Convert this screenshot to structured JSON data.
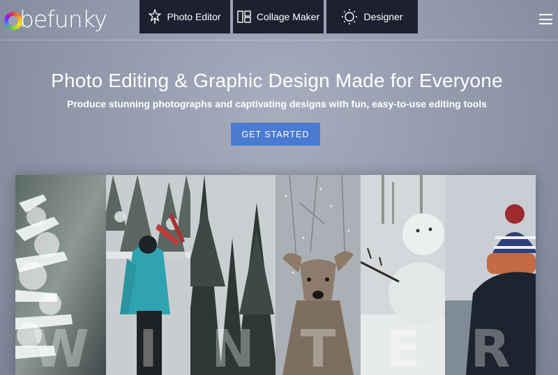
{
  "brand": {
    "logo_text": "befunky"
  },
  "nav": {
    "tabs": [
      {
        "label": "Photo Editor",
        "icon": "star-wand-icon"
      },
      {
        "label": "Collage Maker",
        "icon": "collage-grid-icon"
      },
      {
        "label": "Designer",
        "icon": "designer-sun-icon"
      }
    ],
    "menu_icon": "hamburger-menu-icon"
  },
  "hero": {
    "title": "Photo Editing & Graphic Design Made for Everyone",
    "subtitle": "Produce stunning photographs and captivating designs with fun, easy-to-use editing tools",
    "cta_label": "GET STARTED"
  },
  "gallery": {
    "letters": [
      "W",
      "I",
      "N",
      "T",
      "E",
      "R"
    ]
  },
  "colors": {
    "nav_bg": "#1d2030",
    "cta_bg": "#4a7bd1",
    "page_bg": "#9aa1b2"
  }
}
